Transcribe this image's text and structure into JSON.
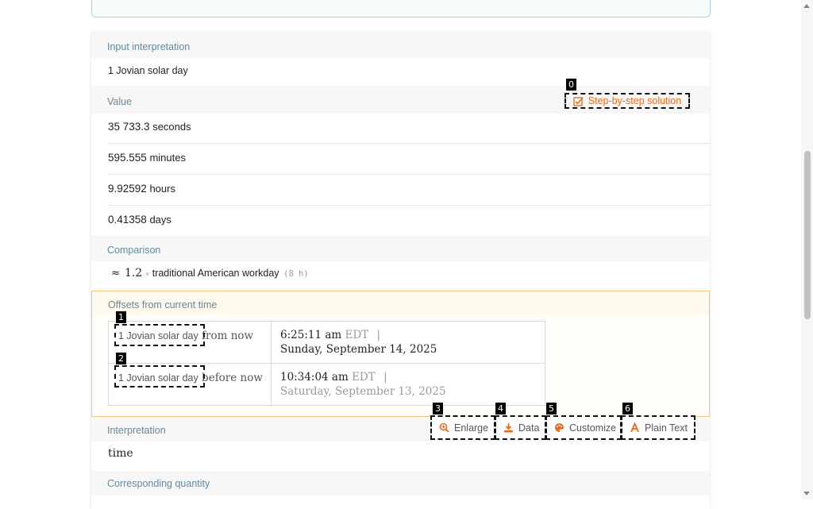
{
  "sections": {
    "input_interpretation": {
      "title": "Input interpretation",
      "value": "1 Jovian solar day"
    },
    "value": {
      "title": "Value",
      "step_button_label": "Step-by-step solution",
      "rows": [
        {
          "number": "35 733.3",
          "unit": "seconds"
        },
        {
          "number": "595.555",
          "unit": "minutes"
        },
        {
          "number": "9.92592",
          "unit": "hours"
        },
        {
          "number": "0.41358",
          "unit": "days"
        }
      ]
    },
    "comparison": {
      "title": "Comparison",
      "approx": "≈",
      "factor": "1.2",
      "times": "×",
      "item": "traditional American workday",
      "note": "(8 h)"
    },
    "offsets": {
      "title": "Offsets from current time",
      "rows": [
        {
          "label_a": "1 Jovian solar day",
          "label_b": " from now",
          "time": "6:25:11 am",
          "tz": "EDT",
          "sep": "|",
          "date": "Sunday, September 14, 2025"
        },
        {
          "label_a": "1 Jovian solar day",
          "label_b": " before now",
          "time": "10:34:04 am",
          "tz": "EDT",
          "sep": "|",
          "date": "Saturday, September 13, 2025"
        }
      ]
    },
    "interpretation": {
      "title": "Interpretation",
      "value": "time"
    },
    "corresponding_quantity": {
      "title": "Corresponding quantity"
    }
  },
  "toolbar": {
    "enlarge": "Enlarge",
    "data": "Data",
    "customize": "Customize",
    "plain_text": "Plain Text"
  },
  "badges": [
    "0",
    "1",
    "2",
    "3",
    "4",
    "5",
    "6"
  ],
  "colors": {
    "accent": "#e66a1f",
    "section_title": "#65879c",
    "offsets_border": "#f4c57e"
  }
}
